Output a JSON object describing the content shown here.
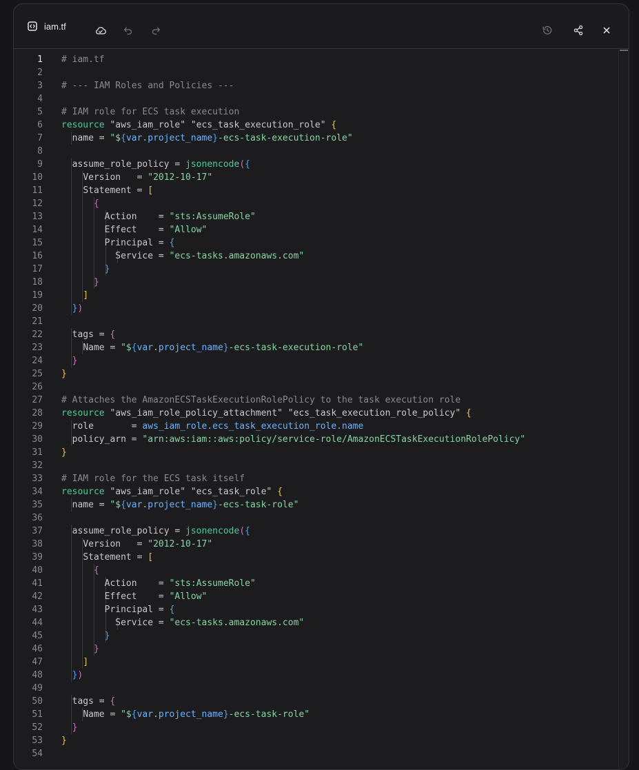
{
  "file": {
    "name": "iam.tf"
  },
  "toolbar": {
    "icons": [
      "file-code-icon",
      "cloud-sync-icon",
      "undo-icon",
      "redo-icon",
      "history-icon",
      "share-icon",
      "close-icon"
    ]
  },
  "colors": {
    "background": "#1c1c1e",
    "keyword": "#4ec99a",
    "string": "#86d4a3",
    "reference": "#6ab4ff",
    "bracket_level1": "#e6c84f",
    "bracket_level2": "#d16dc6",
    "bracket_level3": "#4aa3f0",
    "comment": "#8a8a8f"
  },
  "editor": {
    "active_line": 1,
    "lines": [
      {
        "n": "1",
        "text": "# iam.tf"
      },
      {
        "n": "2",
        "text": ""
      },
      {
        "n": "3",
        "text": "# --- IAM Roles and Policies ---"
      },
      {
        "n": "4",
        "text": ""
      },
      {
        "n": "5",
        "text": "# IAM role for ECS task execution"
      },
      {
        "n": "6",
        "text": "resource \"aws_iam_role\" \"ecs_task_execution_role\" {"
      },
      {
        "n": "7",
        "text": "  name = \"${var.project_name}-ecs-task-execution-role\""
      },
      {
        "n": "8",
        "text": ""
      },
      {
        "n": "9",
        "text": "  assume_role_policy = jsonencode({"
      },
      {
        "n": "10",
        "text": "    Version   = \"2012-10-17\""
      },
      {
        "n": "11",
        "text": "    Statement = ["
      },
      {
        "n": "12",
        "text": "      {"
      },
      {
        "n": "13",
        "text": "        Action    = \"sts:AssumeRole\""
      },
      {
        "n": "14",
        "text": "        Effect    = \"Allow\""
      },
      {
        "n": "15",
        "text": "        Principal = {"
      },
      {
        "n": "16",
        "text": "          Service = \"ecs-tasks.amazonaws.com\""
      },
      {
        "n": "17",
        "text": "        }"
      },
      {
        "n": "18",
        "text": "      }"
      },
      {
        "n": "19",
        "text": "    ]"
      },
      {
        "n": "20",
        "text": "  })"
      },
      {
        "n": "21",
        "text": ""
      },
      {
        "n": "22",
        "text": "  tags = {"
      },
      {
        "n": "23",
        "text": "    Name = \"${var.project_name}-ecs-task-execution-role\""
      },
      {
        "n": "24",
        "text": "  }"
      },
      {
        "n": "25",
        "text": "}"
      },
      {
        "n": "26",
        "text": ""
      },
      {
        "n": "27",
        "text": "# Attaches the AmazonECSTaskExecutionRolePolicy to the task execution role"
      },
      {
        "n": "28",
        "text": "resource \"aws_iam_role_policy_attachment\" \"ecs_task_execution_role_policy\" {"
      },
      {
        "n": "29",
        "text": "  role       = aws_iam_role.ecs_task_execution_role.name"
      },
      {
        "n": "30",
        "text": "  policy_arn = \"arn:aws:iam::aws:policy/service-role/AmazonECSTaskExecutionRolePolicy\""
      },
      {
        "n": "31",
        "text": "}"
      },
      {
        "n": "32",
        "text": ""
      },
      {
        "n": "33",
        "text": "# IAM role for the ECS task itself"
      },
      {
        "n": "34",
        "text": "resource \"aws_iam_role\" \"ecs_task_role\" {"
      },
      {
        "n": "35",
        "text": "  name = \"${var.project_name}-ecs-task-role\""
      },
      {
        "n": "36",
        "text": ""
      },
      {
        "n": "37",
        "text": "  assume_role_policy = jsonencode({"
      },
      {
        "n": "38",
        "text": "    Version   = \"2012-10-17\""
      },
      {
        "n": "39",
        "text": "    Statement = ["
      },
      {
        "n": "40",
        "text": "      {"
      },
      {
        "n": "41",
        "text": "        Action    = \"sts:AssumeRole\""
      },
      {
        "n": "42",
        "text": "        Effect    = \"Allow\""
      },
      {
        "n": "43",
        "text": "        Principal = {"
      },
      {
        "n": "44",
        "text": "          Service = \"ecs-tasks.amazonaws.com\""
      },
      {
        "n": "45",
        "text": "        }"
      },
      {
        "n": "46",
        "text": "      }"
      },
      {
        "n": "47",
        "text": "    ]"
      },
      {
        "n": "48",
        "text": "  })"
      },
      {
        "n": "49",
        "text": ""
      },
      {
        "n": "50",
        "text": "  tags = {"
      },
      {
        "n": "51",
        "text": "    Name = \"${var.project_name}-ecs-task-role\""
      },
      {
        "n": "52",
        "text": "  }"
      },
      {
        "n": "53",
        "text": "}"
      },
      {
        "n": "54",
        "text": ""
      }
    ]
  }
}
